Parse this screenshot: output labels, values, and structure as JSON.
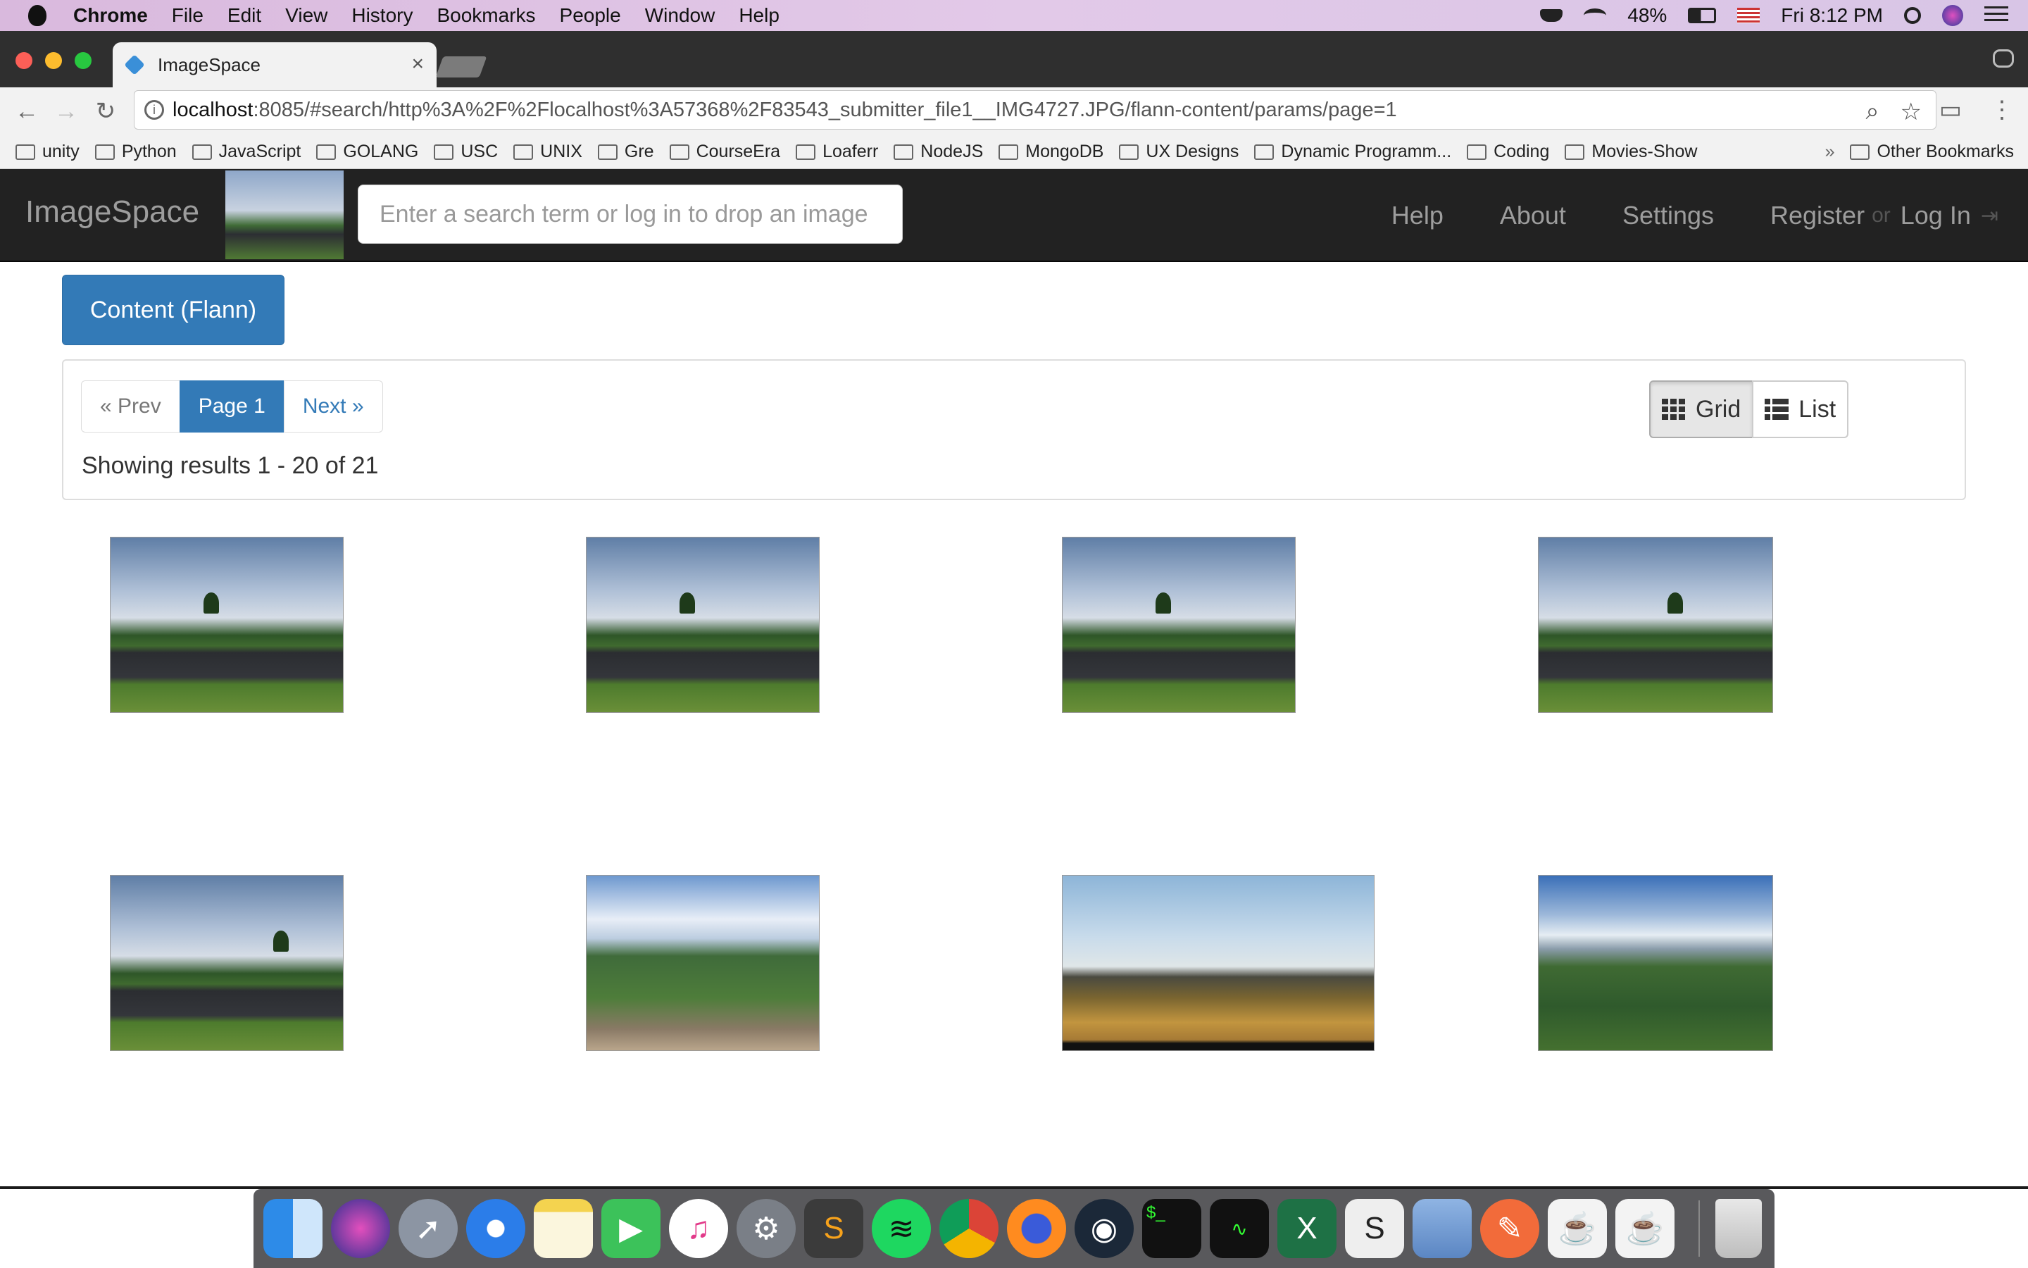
{
  "mac_menubar": {
    "app_name": "Chrome",
    "menus": [
      "File",
      "Edit",
      "View",
      "History",
      "Bookmarks",
      "People",
      "Window",
      "Help"
    ],
    "battery": "48%",
    "clock": "Fri 8:12 PM"
  },
  "browser": {
    "tab_title": "ImageSpace",
    "tab_close": "×",
    "url_host": "localhost",
    "url_rest": ":8085/#search/http%3A%2F%2Flocalhost%3A57368%2F83543_submitter_file1__IMG4727.JPG/flann-content/params/page=1",
    "bookmarks": [
      "unity",
      "Python",
      "JavaScript",
      "GOLANG",
      "USC",
      "UNIX",
      "Gre",
      "CourseEra",
      "Loaferr",
      "NodeJS",
      "MongoDB",
      "UX Designs",
      "Dynamic Programm...",
      "Coding",
      "Movies-Show"
    ],
    "bookmarks_overflow": "»",
    "other_bookmarks": "Other Bookmarks"
  },
  "navbar": {
    "brand": "ImageSpace",
    "search_placeholder": "Enter a search term or log in to drop an image",
    "links": [
      "Help",
      "About",
      "Settings"
    ],
    "register": "Register",
    "or": "or",
    "login": "Log In"
  },
  "content_button": "Content (Flann)",
  "pager": {
    "prev": "« Prev",
    "current": "Page 1",
    "next": "Next »"
  },
  "results_text": "Showing results 1 - 20 of 21",
  "view_toggle": {
    "grid": "Grid",
    "list": "List",
    "active": "grid"
  },
  "results": [
    {
      "style": "track"
    },
    {
      "style": "track"
    },
    {
      "style": "track"
    },
    {
      "style": "track"
    },
    {
      "style": "track"
    },
    {
      "style": "valley"
    },
    {
      "style": "ridge"
    },
    {
      "style": "mountain"
    }
  ],
  "dock_apps": [
    "finder-icon",
    "siri-icon",
    "launchpad-icon",
    "safari-icon",
    "notes-icon",
    "facetime-icon",
    "itunes-icon",
    "system-preferences-icon",
    "sublime-text-icon",
    "spotify-icon",
    "chrome-icon",
    "firefox-icon",
    "steam-icon",
    "terminal-icon",
    "activity-monitor-icon",
    "excel-icon",
    "sublime-s-icon",
    "preview-icon",
    "postman-icon",
    "java-icon",
    "java-icon",
    "trash-icon"
  ]
}
